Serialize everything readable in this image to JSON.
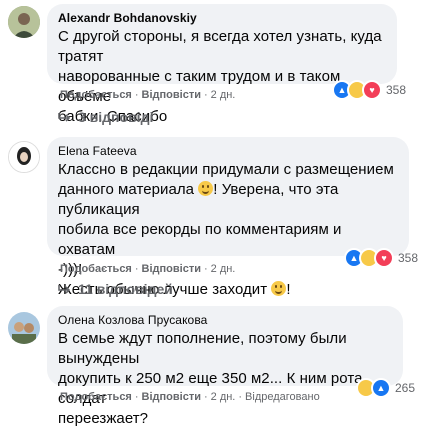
{
  "comments": [
    {
      "author": "Alexandr Bohdanovskiy",
      "text": "С другой стороны, я всегда хотел узнать, куда тратят\nнавoрованные с таким трудом и в таком объёме\nбабки. Спасибо",
      "actions": {
        "like": "Подобається",
        "reply": "Відповісти",
        "time": "2 дн."
      },
      "reaction_count": "358",
      "replies_label": "3 відповіді"
    },
    {
      "author": "Elena Fateeva",
      "text_line1": "Классно в редакции придумали с размещением",
      "text_line2_a": "данного материала",
      "text_line2_b": "! Уверена, что эта публикация",
      "text_line3": "побила все рекорды по комментариям и охватам",
      "text_line4": "-)))!",
      "text_line5": "Жесть обычно лучше заходит",
      "text_line5_b": "!",
      "actions": {
        "like": "Подобається",
        "reply": "Відповісти",
        "time": "2 дн."
      },
      "reaction_count": "358",
      "replies_label": "11 відповідей"
    },
    {
      "author": "Олена Козлова Прусакова",
      "text": "В семье ждут пополнение, поэтому были вынуждены\nдокупить к 250 м2 еще 350 м2... К ним рота солдат\nпереезжает?",
      "actions": {
        "like": "Подобається",
        "reply": "Відповісти",
        "time": "2 дн.",
        "edited": "Відредаговано"
      },
      "reaction_count": "265"
    }
  ],
  "colors": {
    "bubble": "#f0f2f5",
    "muted": "#65676b",
    "like": "#1877f2",
    "haha": "#f7c948",
    "love": "#f33e58"
  },
  "icons": [
    "like-reaction-icon",
    "love-reaction-icon",
    "haha-reaction-icon",
    "reply-arrow-icon",
    "smile-emoji"
  ]
}
